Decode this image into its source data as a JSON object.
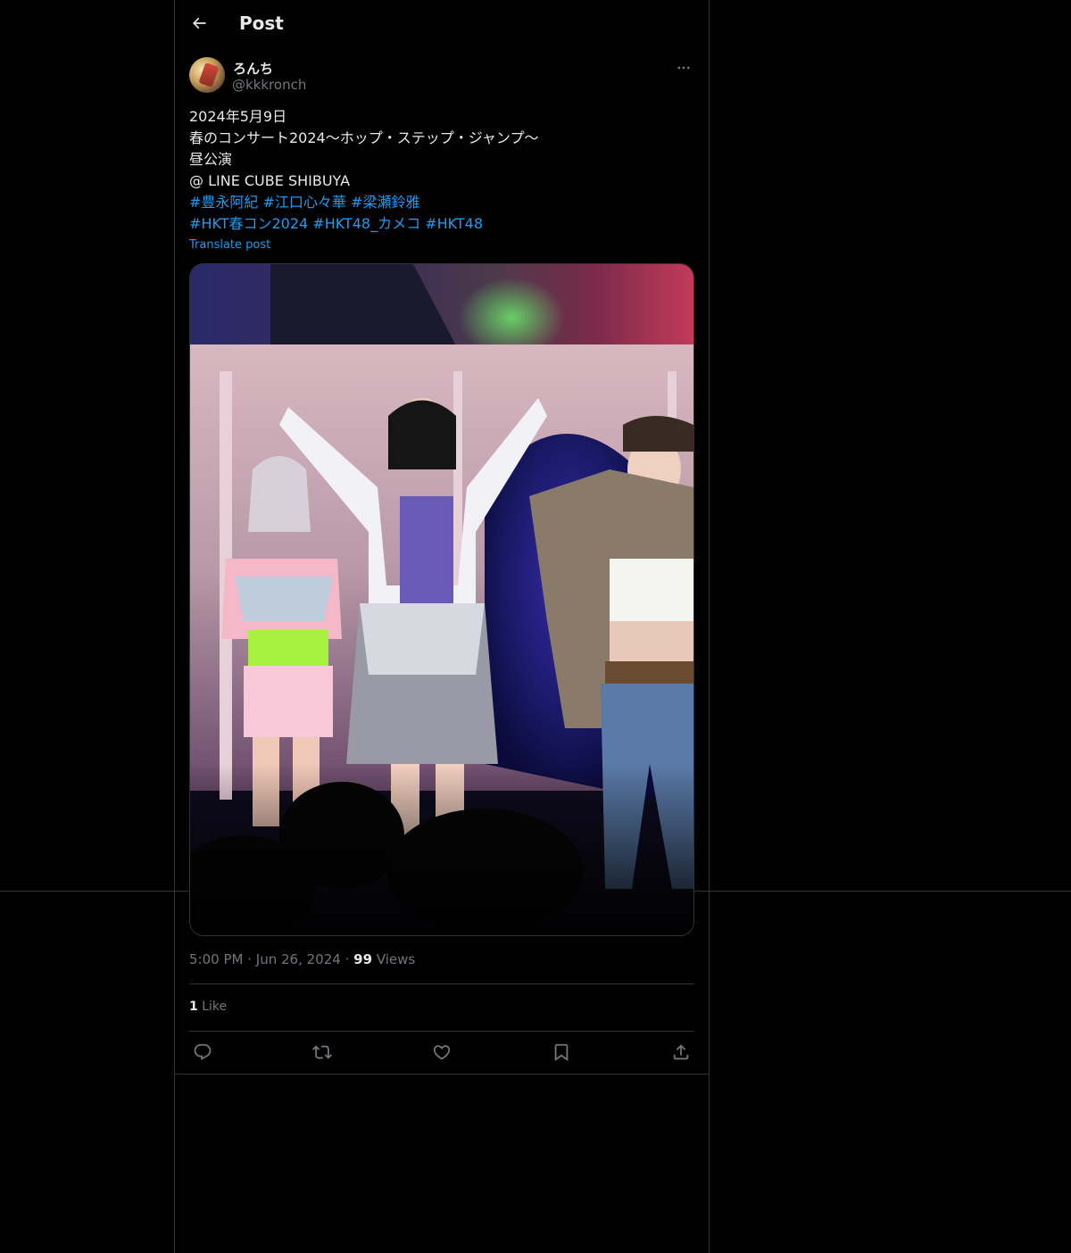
{
  "header": {
    "title": "Post",
    "back_icon": "arrow-left-icon"
  },
  "author": {
    "name": "ろんち",
    "handle": "@kkkronch",
    "more_icon": "more-horizontal-icon"
  },
  "tweet": {
    "lines": [
      "2024年5月9日",
      "春のコンサート2024〜ホップ・ステップ・ジャンプ〜",
      "昼公演",
      "@ LINE CUBE SHIBUYA"
    ],
    "hashtags_line1": [
      "#豊永阿紀",
      "#江口心々華",
      "#梁瀬鈴雅"
    ],
    "hashtags_line2": [
      "#HKT春コン2024",
      "#HKT48_カメコ",
      "#HKT48"
    ],
    "translate_label": "Translate post"
  },
  "meta": {
    "time": "5:00 PM",
    "date": "Jun 26, 2024",
    "separator": "·",
    "views_count": "99",
    "views_label": "Views"
  },
  "likes": {
    "count": "1",
    "label": "Like"
  },
  "actions": [
    "reply-icon",
    "repost-icon",
    "like-icon",
    "bookmark-icon",
    "share-icon"
  ],
  "colors": {
    "background": "#000000",
    "text": "#e7e9ea",
    "muted": "#71767b",
    "link": "#1d9bf0",
    "border": "#2f3336"
  }
}
